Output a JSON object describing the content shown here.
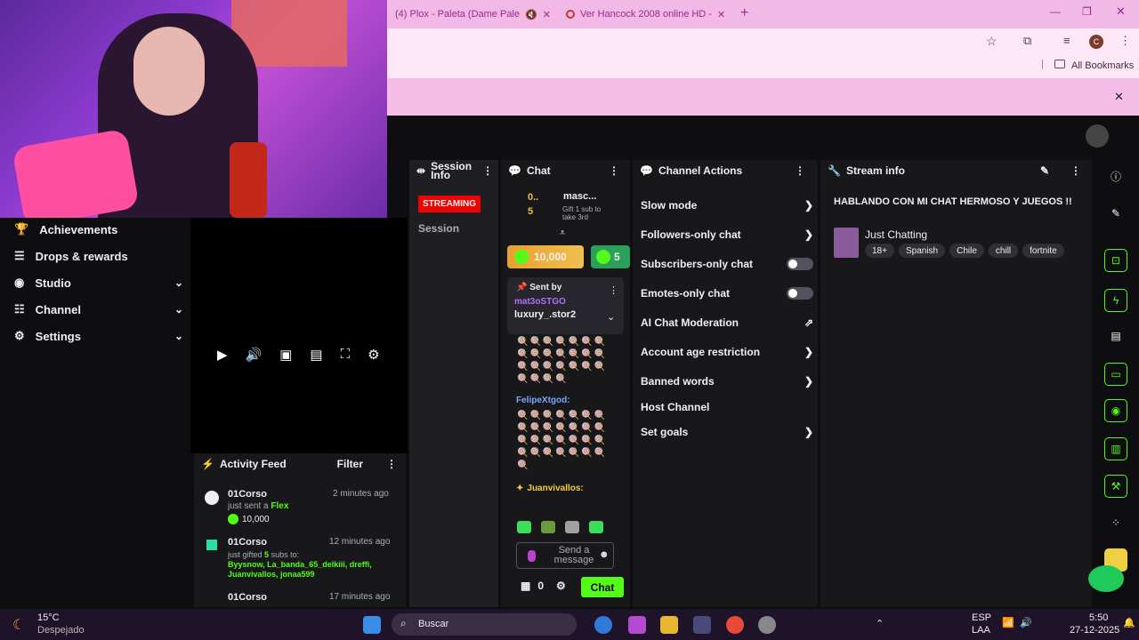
{
  "browser": {
    "tabs": [
      {
        "title": "(4) Plox - Paleta (Dame Pale"
      },
      {
        "title": "Ver Hancock 2008 online HD -"
      }
    ],
    "bookmarks_label": "All Bookmarks",
    "avatar_letter": "C"
  },
  "nav": {
    "items": [
      {
        "label": "Achievements",
        "icon": "trophy-icon"
      },
      {
        "label": "Drops & rewards",
        "icon": "gift-icon"
      },
      {
        "label": "Studio",
        "icon": "sliders-icon"
      },
      {
        "label": "Channel",
        "icon": "people-icon"
      },
      {
        "label": "Settings",
        "icon": "gear-icon"
      }
    ]
  },
  "activity": {
    "title": "Activity Feed",
    "filter": "Filter",
    "entries": [
      {
        "user": "01Corso",
        "time": "2 minutes ago",
        "action": "just sent a",
        "item": "Flex",
        "amount": "10,000"
      },
      {
        "user": "01Corso",
        "time": "12 minutes ago",
        "action": "just gifted",
        "count": "5",
        "rest": "subs to:",
        "recipients": "Byysnow, La_banda_65_delkiii, dreffi, Juanvivallos, jonaa599"
      },
      {
        "user": "01Corso",
        "time": "17 minutes ago"
      }
    ]
  },
  "session": {
    "title": "Session Info",
    "status": "STREAMING",
    "tab": "Session"
  },
  "chat": {
    "title": "Chat",
    "pinned_user": "masc...",
    "pinned_count": "0..",
    "gift_count": "5",
    "gift_text": "Gift 1 sub to take 3rd",
    "badge_amount": "10,000",
    "badge2": "5",
    "pin_label": "Sent by",
    "pin_user": "mat3oSTGO",
    "pin_msg": "luxury_.stor2",
    "user1": "FelipeXtgod:",
    "user2": "Juanvivallos:",
    "placeholder": "Send a message",
    "points": "0",
    "send": "Chat"
  },
  "actions": {
    "title": "Channel Actions",
    "items": [
      "Slow mode",
      "Followers-only chat",
      "Subscribers-only chat",
      "Emotes-only chat",
      "AI Chat Moderation",
      "Account age restriction",
      "Banned words",
      "Host Channel",
      "Set goals"
    ]
  },
  "stream": {
    "title": "Stream info",
    "stream_title": "HABLANDO CON MI CHAT HERMOSO Y JUEGOS !!",
    "category": "Just Chatting",
    "tags": [
      "18+",
      "Spanish",
      "Chile",
      "chill",
      "fortnite"
    ]
  },
  "taskbar": {
    "temp": "15°C",
    "weather": "Despejado",
    "search": "Buscar",
    "lang1": "ESP",
    "lang2": "LAA",
    "time": "5:50",
    "date": "27-12-2025"
  },
  "colors": {
    "accent_green": "#53fc18",
    "streaming_red": "#eb0400"
  }
}
